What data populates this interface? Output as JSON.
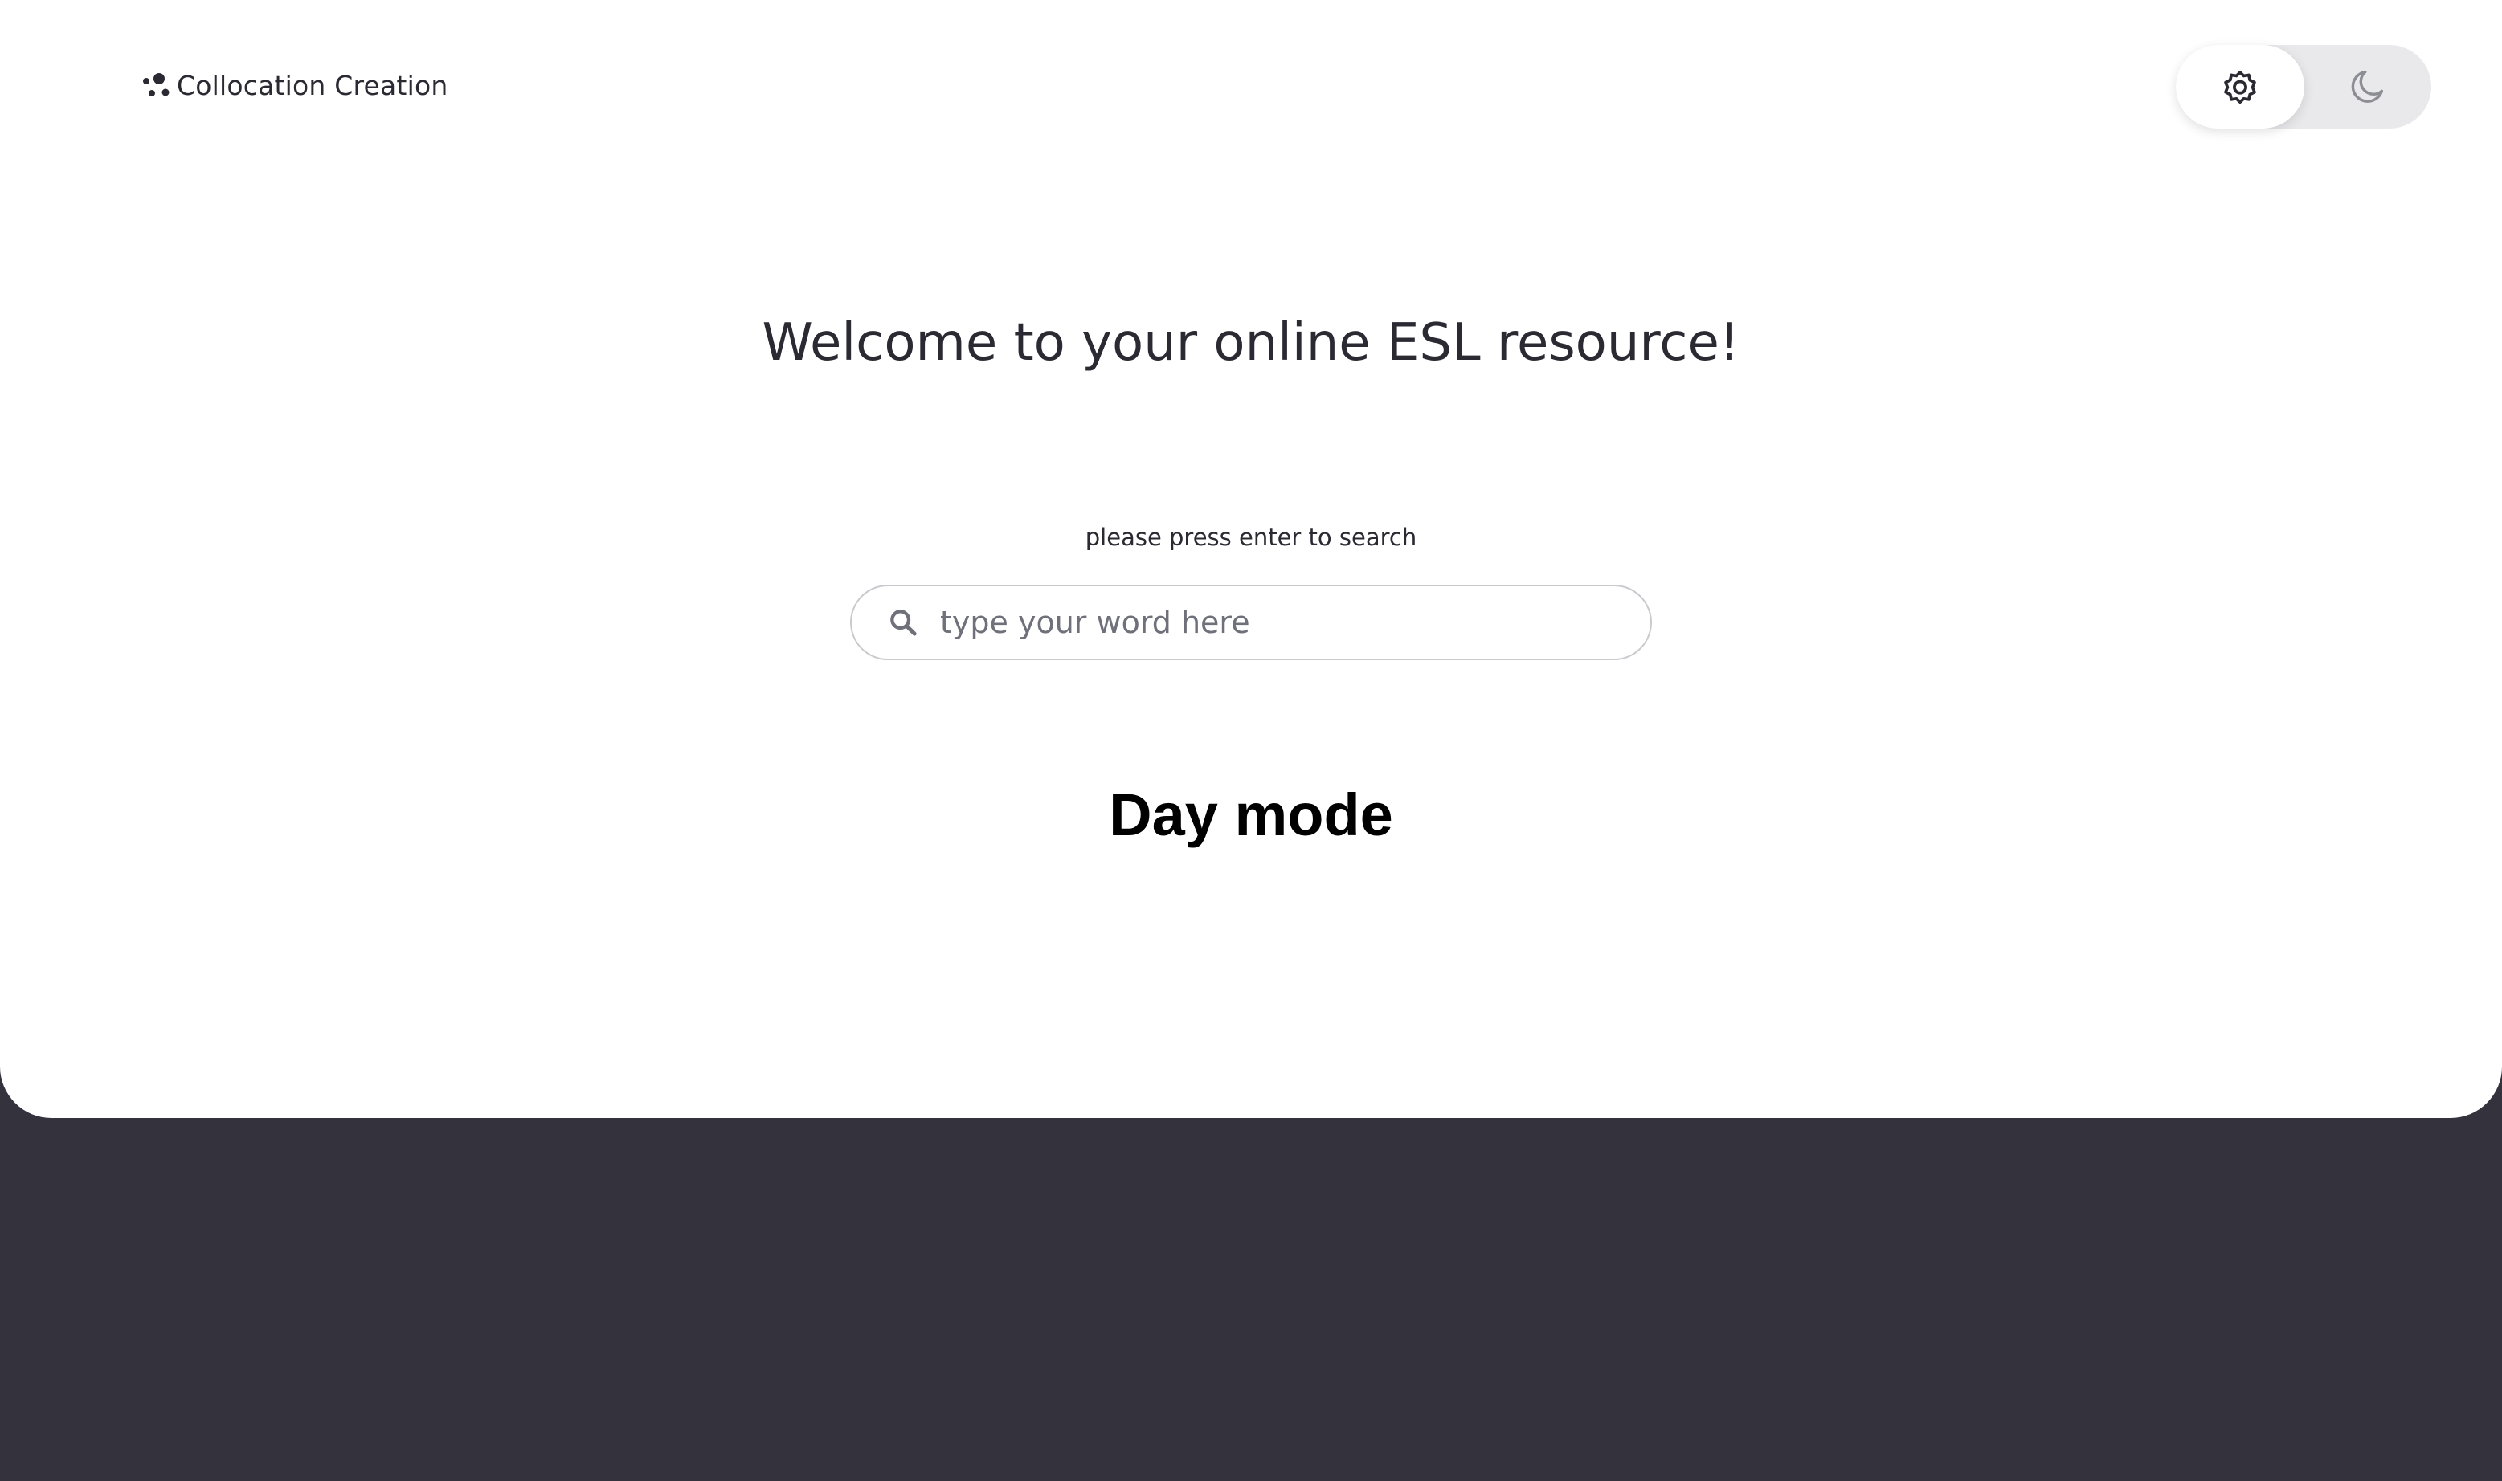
{
  "header": {
    "logo_text": "Collocation Creation",
    "logo_icon": "dots-logo-icon"
  },
  "theme_toggle": {
    "day_icon": "gear-sun-icon",
    "night_icon": "moon-icon",
    "selected": "day"
  },
  "main": {
    "title": "Welcome to your online ESL resource!",
    "search_hint": "please press enter to search",
    "search_placeholder": "type your word here",
    "search_value": "",
    "mode_label": "Day mode"
  },
  "colors": {
    "background_dark": "#34323d",
    "page": "#ffffff",
    "text": "#2b2a33"
  }
}
